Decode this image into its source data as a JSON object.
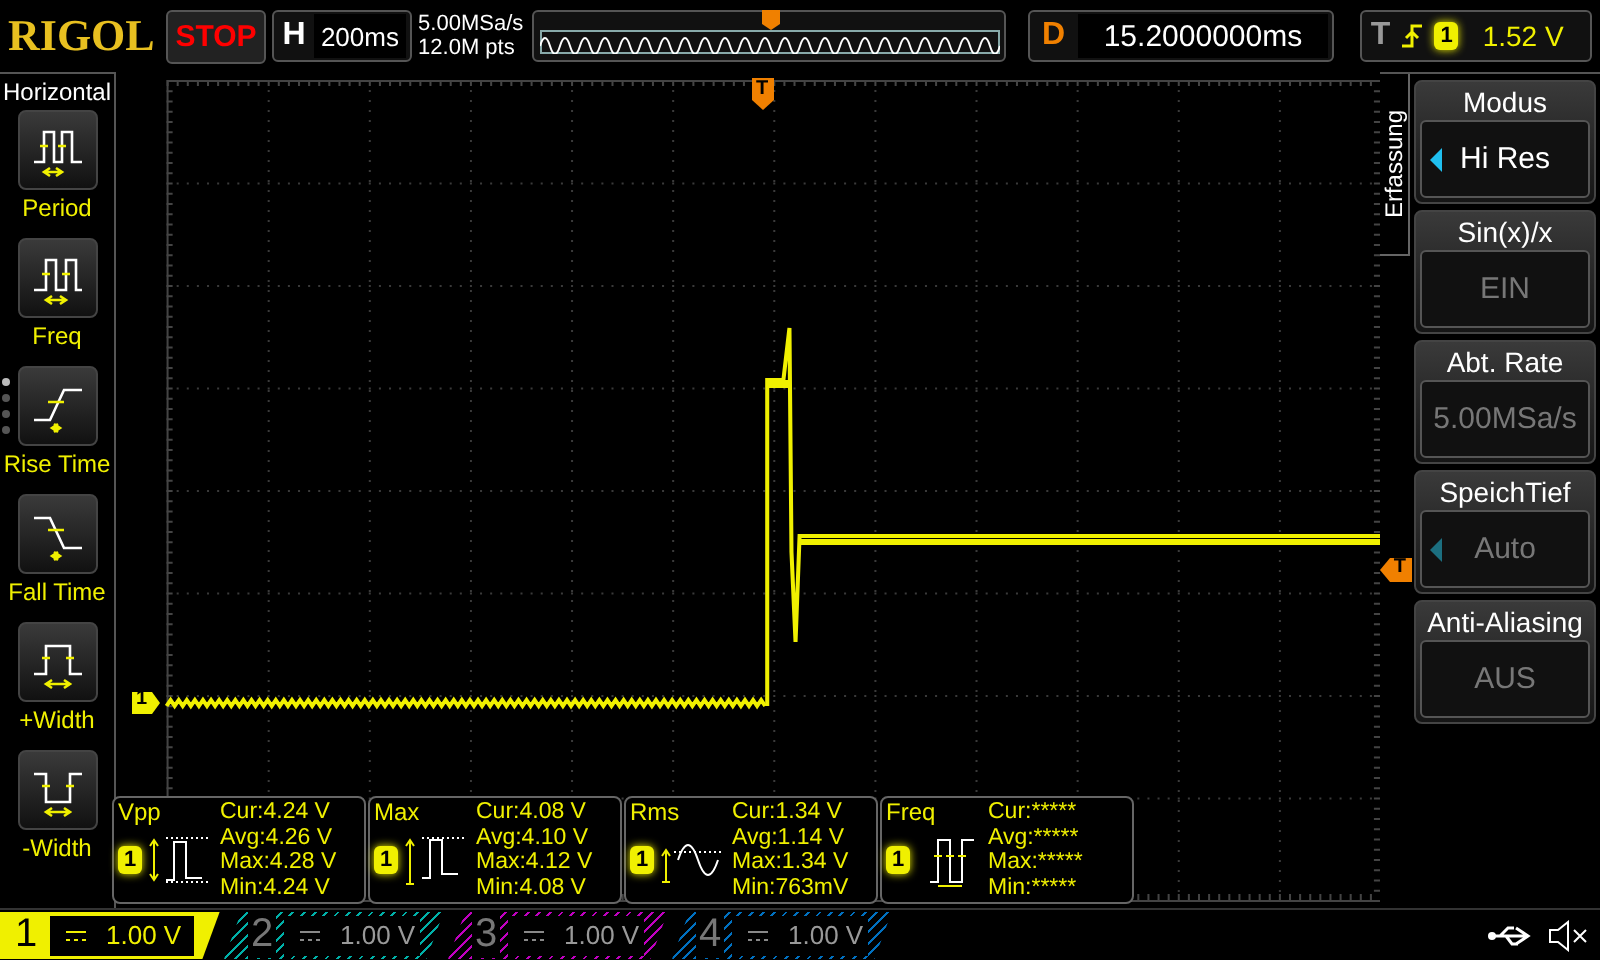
{
  "logo": "RIGOL",
  "run_state": "STOP",
  "timebase": {
    "label": "H",
    "value": "200ms"
  },
  "acquisition": {
    "sample_rate": "5.00MSa/s",
    "memory_depth": "12.0M pts"
  },
  "delay": {
    "label": "D",
    "value": "15.2000000ms"
  },
  "trigger": {
    "label": "T",
    "channel": "1",
    "level": "1.52 V"
  },
  "markers": {
    "trigger_position": "T",
    "trigger_level": "T",
    "channel": "1"
  },
  "left_menu": {
    "title": "Horizontal",
    "pages": [
      {
        "selected": true
      },
      {
        "selected": false
      },
      {
        "selected": false
      },
      {
        "selected": false
      }
    ],
    "items": [
      {
        "label": "Period",
        "kind": "period"
      },
      {
        "label": "Freq",
        "kind": "freq"
      },
      {
        "label": "Rise Time",
        "kind": "rise"
      },
      {
        "label": "Fall Time",
        "kind": "fall"
      },
      {
        "label": "+Width",
        "kind": "pwidth"
      },
      {
        "label": "-Width",
        "kind": "nwidth"
      }
    ]
  },
  "right_menu": {
    "title": "Erfassung",
    "items": [
      {
        "title": "Modus",
        "value": "Hi Res",
        "disabled": false,
        "arrow": true
      },
      {
        "title": "Sin(x)/x",
        "value": "EIN",
        "disabled": true,
        "arrow": false
      },
      {
        "title": "Abt. Rate",
        "value": "5.00MSa/s",
        "disabled": true,
        "arrow": false
      },
      {
        "title": "SpeichTief",
        "value": "Auto",
        "disabled": true,
        "arrow": true
      },
      {
        "title": "Anti-Aliasing",
        "value": "AUS",
        "disabled": true,
        "arrow": false
      }
    ]
  },
  "measurements": [
    {
      "name": "Vpp",
      "channel": "1",
      "kind": "vpp",
      "stats": [
        "Cur:4.24 V",
        "Avg:4.26 V",
        "Max:4.28 V",
        "Min:4.24 V"
      ]
    },
    {
      "name": "Max",
      "channel": "1",
      "kind": "max",
      "stats": [
        "Cur:4.08 V",
        "Avg:4.10 V",
        "Max:4.12 V",
        "Min:4.08 V"
      ]
    },
    {
      "name": "Rms",
      "channel": "1",
      "kind": "rms",
      "stats": [
        "Cur:1.34 V",
        "Avg:1.14 V",
        "Max:1.34 V",
        "Min:763mV"
      ]
    },
    {
      "name": "Freq",
      "channel": "1",
      "kind": "freq",
      "stats": [
        "Cur:*****",
        "Avg:*****",
        "Max:*****",
        "Min:*****"
      ]
    }
  ],
  "channels": [
    {
      "number": "1",
      "scale": "1.00 V",
      "on": true,
      "color": "#f0f000"
    },
    {
      "number": "2",
      "scale": "1.00 V",
      "on": false,
      "color": "#00b0a8"
    },
    {
      "number": "3",
      "scale": "1.00 V",
      "on": false,
      "color": "#c000c0"
    },
    {
      "number": "4",
      "scale": "1.00 V",
      "on": false,
      "color": "#0070c0"
    }
  ]
}
